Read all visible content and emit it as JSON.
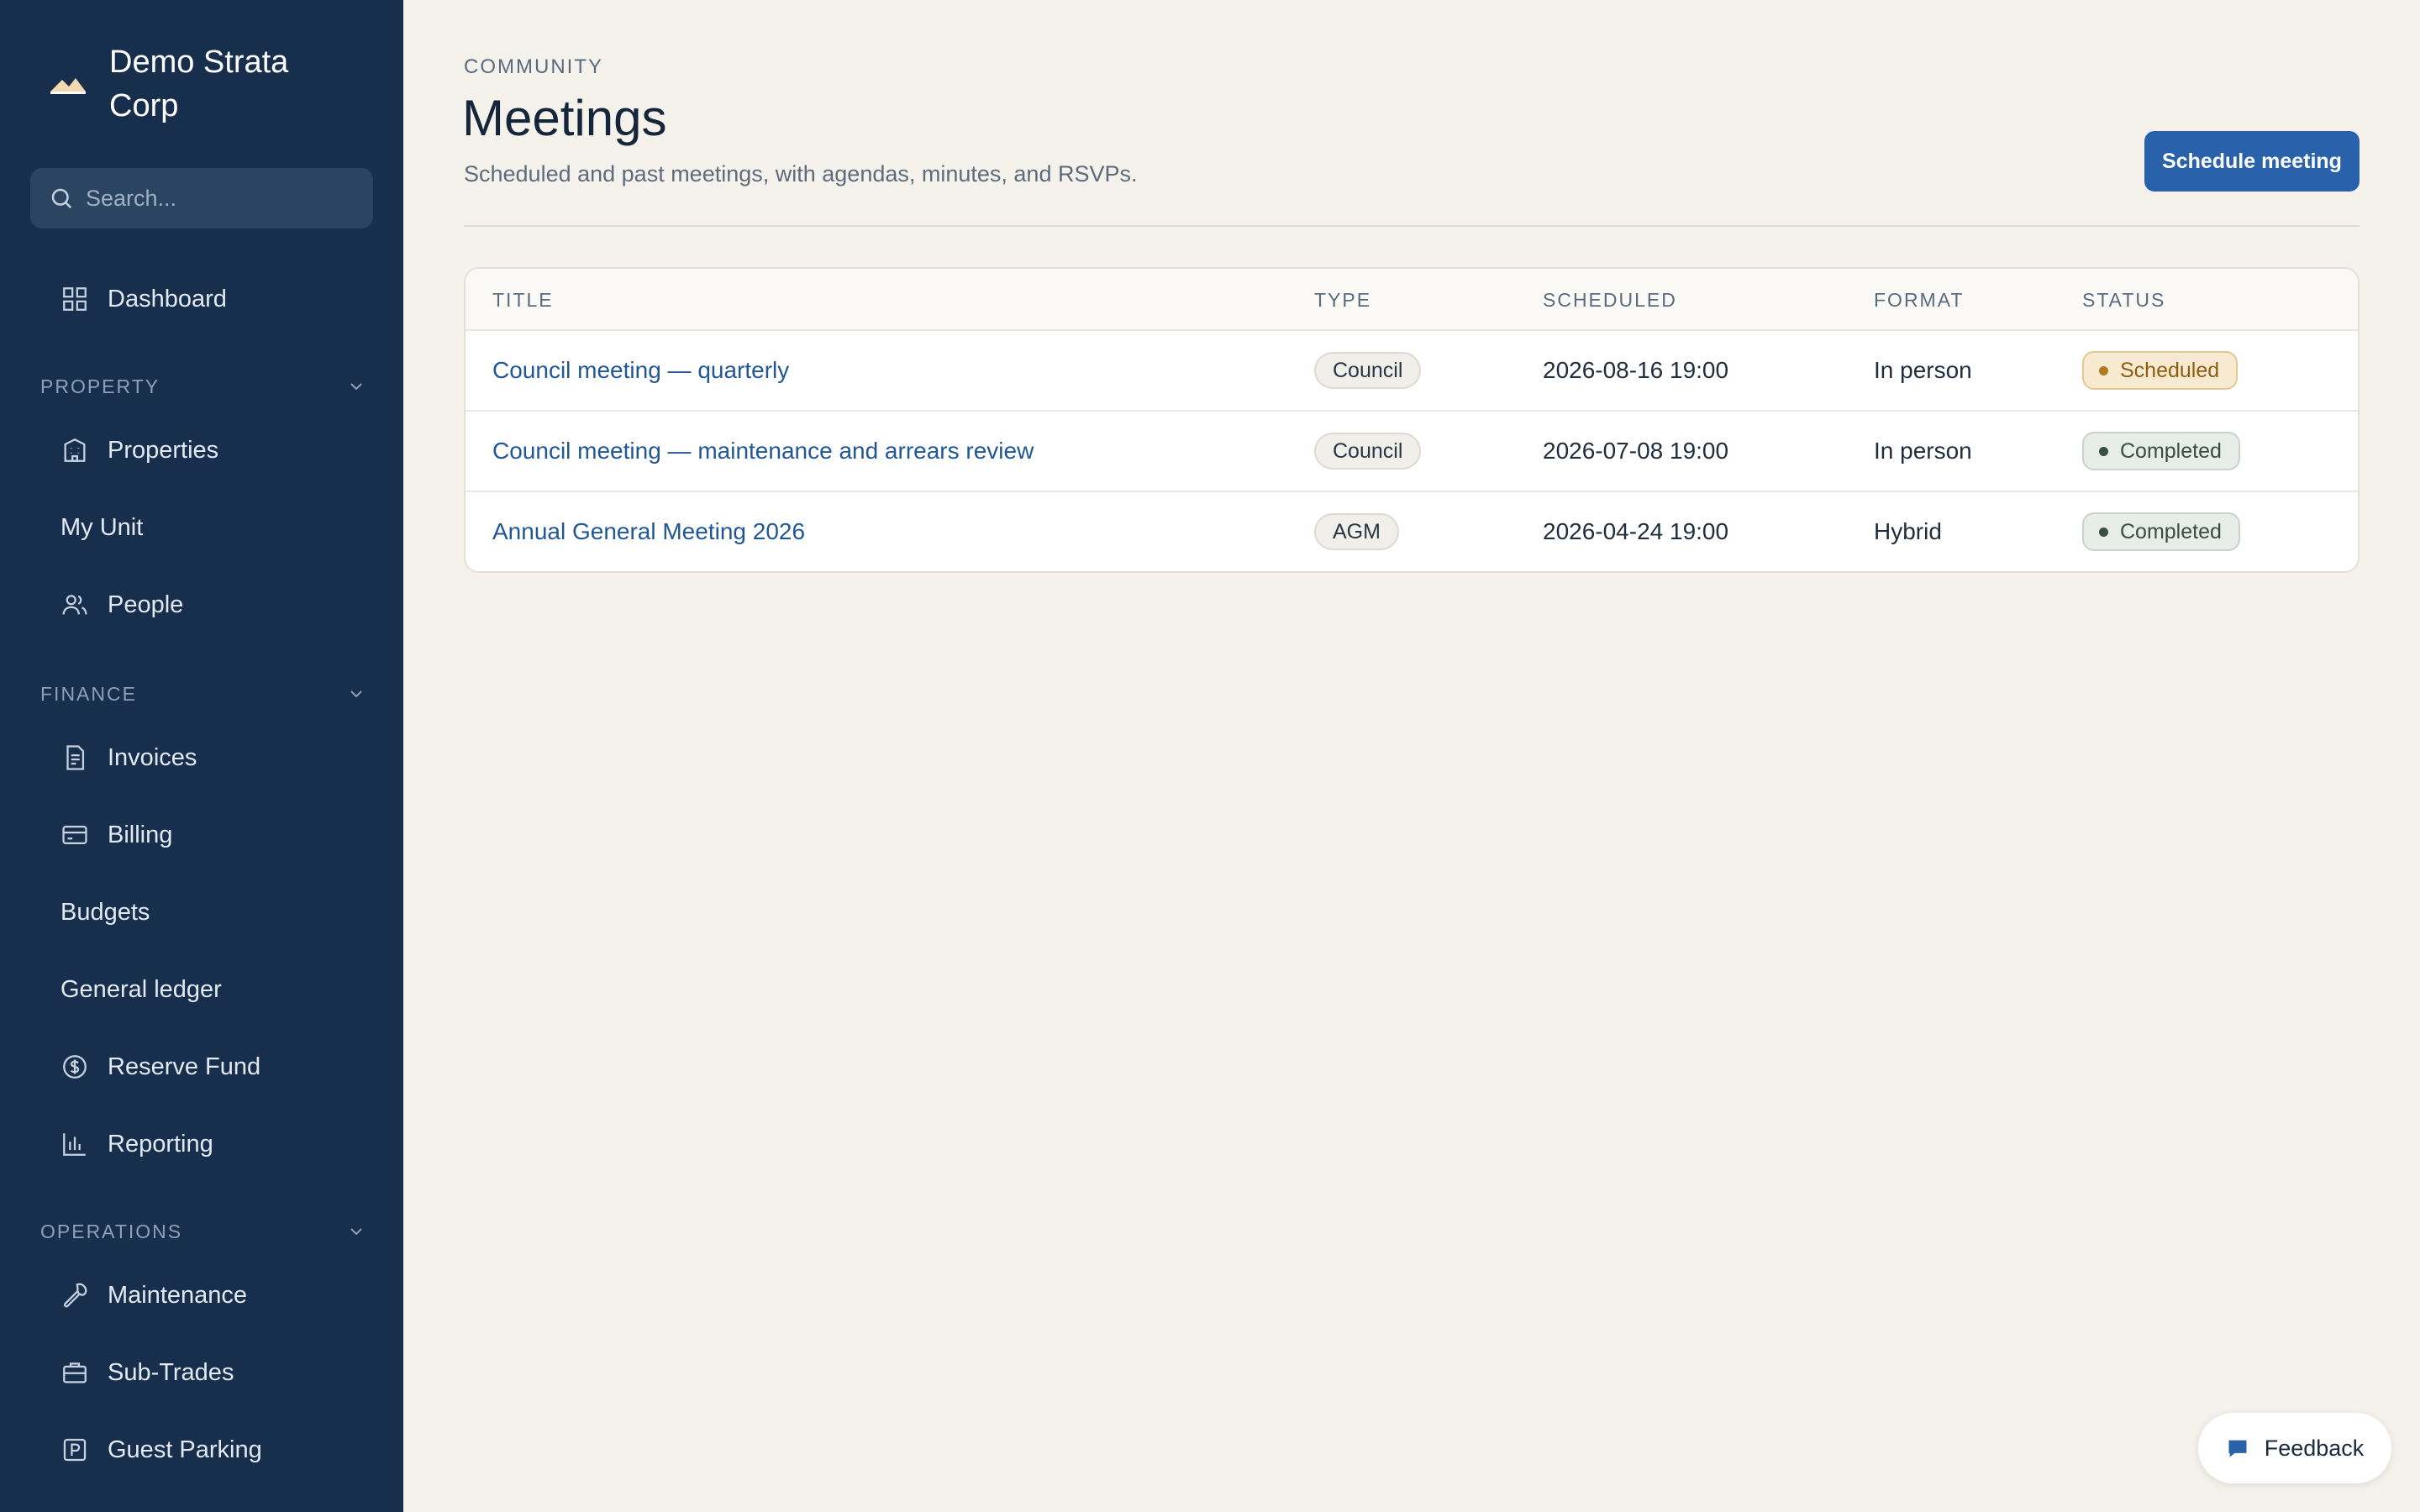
{
  "sidebar": {
    "brand": "Demo Strata Corp",
    "search_placeholder": "Search...",
    "dashboard": "Dashboard",
    "sections": {
      "property": "PROPERTY",
      "finance": "FINANCE",
      "operations": "OPERATIONS"
    },
    "items": {
      "properties": "Properties",
      "my_unit": "My Unit",
      "people": "People",
      "invoices": "Invoices",
      "billing": "Billing",
      "budgets": "Budgets",
      "general_ledger": "General ledger",
      "reserve_fund": "Reserve Fund",
      "reporting": "Reporting",
      "maintenance": "Maintenance",
      "sub_trades": "Sub-Trades",
      "guest_parking": "Guest Parking"
    }
  },
  "header": {
    "eyebrow": "COMMUNITY",
    "title": "Meetings",
    "subtitle": "Scheduled and past meetings, with agendas, minutes, and RSVPs.",
    "primary_action": "Schedule meeting"
  },
  "table": {
    "columns": [
      "TITLE",
      "TYPE",
      "SCHEDULED",
      "FORMAT",
      "STATUS"
    ],
    "rows": [
      {
        "title": "Council meeting — quarterly",
        "type": "Council",
        "scheduled": "2026-08-16 19:00",
        "format": "In person",
        "status": "Scheduled"
      },
      {
        "title": "Council meeting — maintenance and arrears review",
        "type": "Council",
        "scheduled": "2026-07-08 19:00",
        "format": "In person",
        "status": "Completed"
      },
      {
        "title": "Annual General Meeting 2026",
        "type": "AGM",
        "scheduled": "2026-04-24 19:00",
        "format": "Hybrid",
        "status": "Completed"
      }
    ]
  },
  "feedback_label": "Feedback",
  "colors": {
    "sidebar_bg": "#172f4c",
    "page_bg": "#f5f2ec",
    "accent": "#2962ab",
    "link": "#215796",
    "scheduled": "#8a5d12",
    "completed": "#3a4b43"
  }
}
